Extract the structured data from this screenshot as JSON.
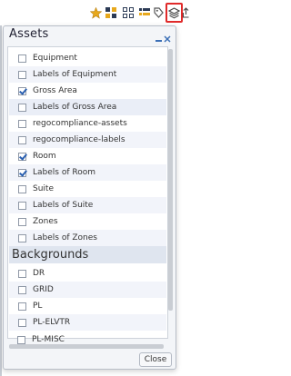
{
  "toolbar": {
    "icons": [
      "star-icon",
      "grid-icon",
      "grid-outline-icon",
      "list-icon",
      "tag-icon",
      "layers-icon",
      "share-icon"
    ],
    "accent": "#e02a2a",
    "star_color": "#e7a81c"
  },
  "popup": {
    "title": "Assets",
    "close_label": "Close",
    "assets": [
      {
        "label": "Equipment",
        "checked": false
      },
      {
        "label": "Labels of Equipment",
        "checked": false
      },
      {
        "label": "Gross Area",
        "checked": true
      },
      {
        "label": "Labels of Gross Area",
        "checked": false
      },
      {
        "label": "regocompliance-assets",
        "checked": false
      },
      {
        "label": "regocompliance-labels",
        "checked": false
      },
      {
        "label": "Room",
        "checked": true
      },
      {
        "label": "Labels of Room",
        "checked": true
      },
      {
        "label": "Suite",
        "checked": false
      },
      {
        "label": "Labels of Suite",
        "checked": false
      },
      {
        "label": "Zones",
        "checked": false
      },
      {
        "label": "Labels of Zones",
        "checked": false
      }
    ],
    "backgrounds_title": "Backgrounds",
    "backgrounds": [
      {
        "label": "DR",
        "checked": false
      },
      {
        "label": "GRID",
        "checked": false
      },
      {
        "label": "PL",
        "checked": false
      },
      {
        "label": "PL-ELVTR",
        "checked": false
      },
      {
        "label": "PL-MISC",
        "checked": false
      }
    ]
  }
}
